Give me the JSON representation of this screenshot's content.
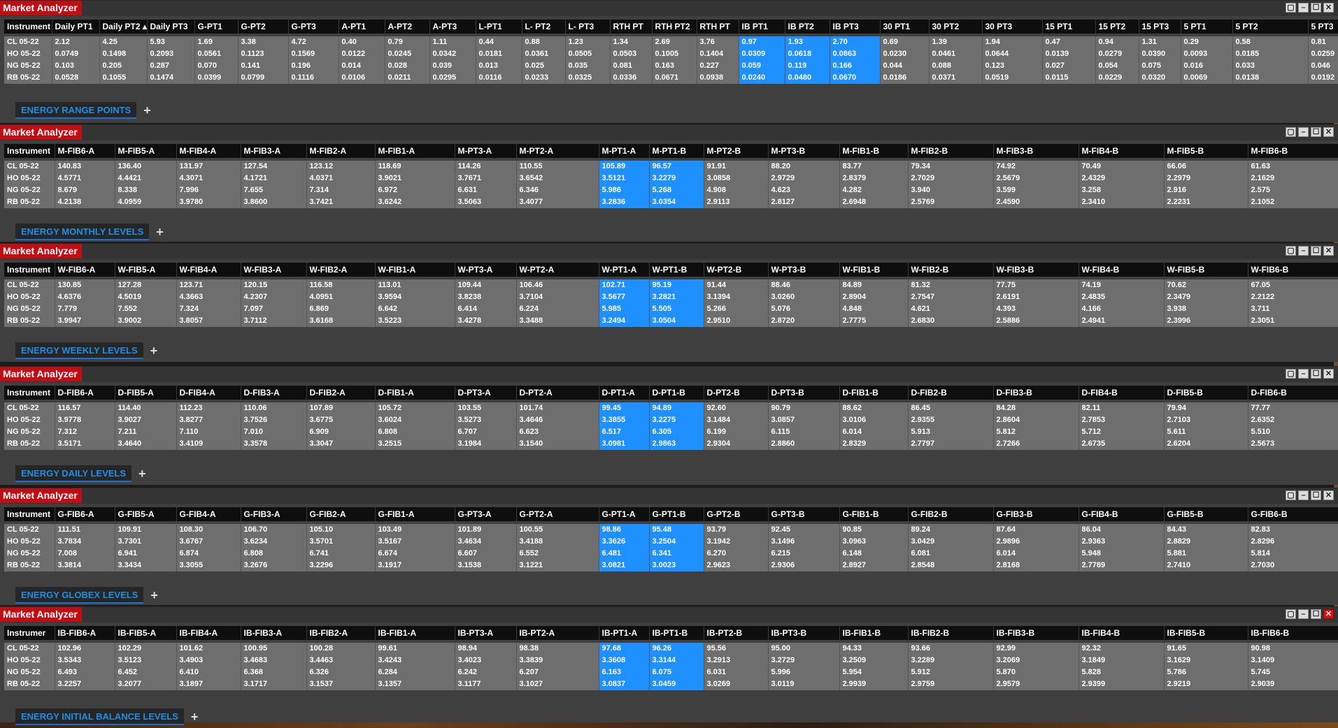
{
  "window_controls": {
    "restore": "▢",
    "minimize": "–",
    "maximize": "☐",
    "close": "✕"
  },
  "add_tab_label": "+",
  "panels": [
    {
      "title": "Market Analyzer",
      "tab": "ENERGY RANGE POINTS",
      "headers": [
        "Instrument",
        "Daily PT1",
        "Daily PT2 ▴",
        "Daily PT3",
        "G-PT1",
        "G-PT2",
        "G-PT3",
        "A-PT1",
        "A-PT2",
        "A-PT3",
        "L-PT1",
        "L- PT2",
        "L- PT3",
        "RTH PT",
        "RTH PT2",
        "RTH PT",
        "IB PT1",
        "IB PT2",
        "IB PT3",
        "30 PT1",
        "30 PT2",
        "30 PT3",
        "15 PT1",
        "15 PT2",
        "15 PT3",
        "5 PT1",
        "5 PT2",
        "5 PT3"
      ],
      "col_widths": [
        68,
        68,
        68,
        68,
        62,
        72,
        72,
        66,
        64,
        66,
        66,
        62,
        64,
        60,
        64,
        60,
        66,
        64,
        72,
        70,
        76,
        86,
        76,
        62,
        60,
        74,
        108,
        74
      ],
      "highlight_cols": [
        16,
        17,
        18
      ],
      "rows": [
        [
          "CL 05-22",
          "2.12",
          "4.25",
          "5.93",
          "1.69",
          "3.38",
          "4.72",
          "0.40",
          "0.79",
          "1.11",
          "0.44",
          "0.88",
          "1.23",
          "1.34",
          "2.69",
          "3.76",
          "0.97",
          "1.93",
          "2.70",
          "0.69",
          "1.39",
          "1.94",
          "0.47",
          "0.94",
          "1.31",
          "0.29",
          "0.58",
          "0.81"
        ],
        [
          "HO 05-22",
          "0.0749",
          "0.1498",
          "0.2093",
          "0.0561",
          "0.1123",
          "0.1569",
          "0.0122",
          "0.0245",
          "0.0342",
          "0.0181",
          "0.0361",
          "0.0505",
          "0.0503",
          "0.1005",
          "0.1404",
          "0.0309",
          "0.0618",
          "0.0863",
          "0.0230",
          "0.0461",
          "0.0644",
          "0.0139",
          "0.0279",
          "0.0390",
          "0.0093",
          "0.0185",
          "0.0259"
        ],
        [
          "NG 05-22",
          "0.103",
          "0.205",
          "0.287",
          "0.070",
          "0.141",
          "0.196",
          "0.014",
          "0.028",
          "0.039",
          "0.013",
          "0.025",
          "0.035",
          "0.081",
          "0.163",
          "0.227",
          "0.059",
          "0.119",
          "0.166",
          "0.044",
          "0.088",
          "0.123",
          "0.027",
          "0.054",
          "0.075",
          "0.016",
          "0.033",
          "0.046"
        ],
        [
          "RB 05-22",
          "0.0528",
          "0.1055",
          "0.1474",
          "0.0399",
          "0.0799",
          "0.1116",
          "0.0106",
          "0.0211",
          "0.0295",
          "0.0116",
          "0.0233",
          "0.0325",
          "0.0336",
          "0.0671",
          "0.0938",
          "0.0240",
          "0.0480",
          "0.0670",
          "0.0186",
          "0.0371",
          "0.0519",
          "0.0115",
          "0.0229",
          "0.0320",
          "0.0069",
          "0.0138",
          "0.0192"
        ]
      ]
    },
    {
      "title": "Market Analyzer",
      "tab": "ENERGY MONTHLY LEVELS",
      "headers": [
        "Instrument",
        "M-FIB6-A",
        "M-FIB5-A",
        "M-FIB4-A",
        "M-FIB3-A",
        "M-FIB2-A",
        "M-FIB1-A",
        "M-PT3-A",
        "M-PT2-A",
        "M-PT1-A",
        "M-PT1-B",
        "M-PT2-B",
        "M-PT3-B",
        "M-FIB1-B",
        "M-FIB2-B",
        "M-FIB3-B",
        "M-FIB4-B",
        "M-FIB5-B",
        "M-FIB6-B"
      ],
      "col_widths": [
        72,
        86,
        88,
        92,
        94,
        98,
        114,
        88,
        118,
        72,
        78,
        92,
        102,
        98,
        122,
        122,
        122,
        120,
        130
      ],
      "highlight_cols": [
        9,
        10
      ],
      "rows": [
        [
          "CL 05-22",
          "140.83",
          "136.40",
          "131.97",
          "127.54",
          "123.12",
          "118.69",
          "114.26",
          "110.55",
          "105.89",
          "96.57",
          "91.91",
          "88.20",
          "83.77",
          "79.34",
          "74.92",
          "70.49",
          "66.06",
          "61.63"
        ],
        [
          "HO 05-22",
          "4.5771",
          "4.4421",
          "4.3071",
          "4.1721",
          "4.0371",
          "3.9021",
          "3.7671",
          "3.6542",
          "3.5121",
          "3.2279",
          "3.0858",
          "2.9729",
          "2.8379",
          "2.7029",
          "2.5679",
          "2.4329",
          "2.2979",
          "2.1629"
        ],
        [
          "NG 05-22",
          "8.679",
          "8.338",
          "7.996",
          "7.655",
          "7.314",
          "6.972",
          "6.631",
          "6.346",
          "5.986",
          "5.268",
          "4.908",
          "4.623",
          "4.282",
          "3.940",
          "3.599",
          "3.258",
          "2.916",
          "2.575"
        ],
        [
          "RB 05-22",
          "4.2138",
          "4.0959",
          "3.9780",
          "3.8600",
          "3.7421",
          "3.6242",
          "3.5063",
          "3.4077",
          "3.2836",
          "3.0354",
          "2.9113",
          "2.8127",
          "2.6948",
          "2.5769",
          "2.4590",
          "2.3410",
          "2.2231",
          "2.1052"
        ]
      ]
    },
    {
      "title": "Market Analyzer",
      "tab": "ENERGY WEEKLY LEVELS",
      "headers": [
        "Instrument",
        "W-FIB6-A",
        "W-FIB5-A",
        "W-FIB4-A",
        "W-FIB3-A",
        "W-FIB2-A",
        "W-FIB1-A",
        "W-PT3-A",
        "W-PT2-A",
        "W-PT1-A",
        "W-PT1-B",
        "W-PT2-B",
        "W-PT3-B",
        "W-FIB1-B",
        "W-FIB2-B",
        "W-FIB3-B",
        "W-FIB4-B",
        "W-FIB5-B",
        "W-FIB6-B"
      ],
      "col_widths": [
        72,
        86,
        88,
        92,
        94,
        98,
        114,
        88,
        118,
        72,
        78,
        92,
        102,
        98,
        122,
        122,
        122,
        120,
        130
      ],
      "highlight_cols": [
        9,
        10
      ],
      "rows": [
        [
          "CL 05-22",
          "130.85",
          "127.28",
          "123.71",
          "120.15",
          "116.58",
          "113.01",
          "109.44",
          "106.46",
          "102.71",
          "95.19",
          "91.44",
          "88.46",
          "84.89",
          "81.32",
          "77.75",
          "74.19",
          "70.62",
          "67.05"
        ],
        [
          "HO 05-22",
          "4.6376",
          "4.5019",
          "4.3663",
          "4.2307",
          "4.0951",
          "3.9594",
          "3.8238",
          "3.7104",
          "3.5677",
          "3.2821",
          "3.1394",
          "3.0260",
          "2.8904",
          "2.7547",
          "2.6191",
          "2.4835",
          "2.3479",
          "2.2122"
        ],
        [
          "NG 05-22",
          "7.779",
          "7.552",
          "7.324",
          "7.097",
          "6.869",
          "6.642",
          "6.414",
          "6.224",
          "5.985",
          "5.505",
          "5.266",
          "5.076",
          "4.848",
          "4.621",
          "4.393",
          "4.166",
          "3.938",
          "3.711"
        ],
        [
          "RB 05-22",
          "3.9947",
          "3.9002",
          "3.8057",
          "3.7112",
          "3.6168",
          "3.5223",
          "3.4278",
          "3.3488",
          "3.2494",
          "3.0504",
          "2.9510",
          "2.8720",
          "2.7775",
          "2.6830",
          "2.5886",
          "2.4941",
          "2.3996",
          "2.3051"
        ]
      ]
    },
    {
      "title": "Market Analyzer",
      "tab": "ENERGY DAILY LEVELS",
      "headers": [
        "Instrument",
        "D-FIB6-A",
        "D-FIB5-A",
        "D-FIB4-A",
        "D-FIB3-A",
        "D-FIB2-A",
        "D-FIB1-A",
        "D-PT3-A",
        "D-PT2-A",
        "D-PT1-A",
        "D-PT1-B",
        "D-PT2-B",
        "D-PT3-B",
        "D-FIB1-B",
        "D-FIB2-B",
        "D-FIB3-B",
        "D-FIB4-B",
        "D-FIB5-B",
        "D-FIB6-B"
      ],
      "col_widths": [
        72,
        86,
        88,
        92,
        94,
        98,
        114,
        88,
        118,
        72,
        78,
        92,
        102,
        98,
        122,
        122,
        122,
        120,
        130
      ],
      "highlight_cols": [
        9,
        10
      ],
      "rows": [
        [
          "CL 05-22",
          "116.57",
          "114.40",
          "112.23",
          "110.06",
          "107.89",
          "105.72",
          "103.55",
          "101.74",
          "99.45",
          "94.89",
          "92.60",
          "90.79",
          "88.62",
          "86.45",
          "84.28",
          "82.11",
          "79.94",
          "77.77"
        ],
        [
          "HO 05-22",
          "3.9778",
          "3.9027",
          "3.8277",
          "3.7526",
          "3.6775",
          "3.6024",
          "3.5273",
          "3.4646",
          "3.3855",
          "3.2275",
          "3.1484",
          "3.0857",
          "3.0106",
          "2.9355",
          "2.8604",
          "2.7853",
          "2.7103",
          "2.6352"
        ],
        [
          "NG 05-22",
          "7.312",
          "7.211",
          "7.110",
          "7.010",
          "6.909",
          "6.808",
          "6.707",
          "6.623",
          "6.517",
          "6.305",
          "6.199",
          "6.115",
          "6.014",
          "5.913",
          "5.812",
          "5.712",
          "5.611",
          "5.510"
        ],
        [
          "RB 05-22",
          "3.5171",
          "3.4640",
          "3.4109",
          "3.3578",
          "3.3047",
          "3.2515",
          "3.1984",
          "3.1540",
          "3.0981",
          "2.9863",
          "2.9304",
          "2.8860",
          "2.8329",
          "2.7797",
          "2.7266",
          "2.6735",
          "2.6204",
          "2.5673"
        ]
      ]
    },
    {
      "title": "Market Analyzer",
      "tab": "ENERGY GLOBEX LEVELS",
      "headers": [
        "Instrument",
        "G-FIB6-A",
        "G-FIB5-A",
        "G-FIB4-A",
        "G-FIB3-A",
        "G-FIB2-A",
        "G-FIB1-A",
        "G-PT3-A",
        "G-PT2-A",
        "G-PT1-A",
        "G-PT1-B",
        "G-PT2-B",
        "G-PT3-B",
        "G-FIB1-B",
        "G-FIB2-B",
        "G-FIB3-B",
        "G-FIB4-B",
        "G-FIB5-B",
        "G-FIB6-B"
      ],
      "col_widths": [
        72,
        86,
        88,
        92,
        94,
        98,
        114,
        88,
        118,
        72,
        78,
        92,
        102,
        98,
        122,
        122,
        122,
        120,
        130
      ],
      "highlight_cols": [
        9,
        10
      ],
      "rows": [
        [
          "CL 05-22",
          "111.51",
          "109.91",
          "108.30",
          "106.70",
          "105.10",
          "103.49",
          "101.89",
          "100.55",
          "98.86",
          "95.48",
          "93.79",
          "92.45",
          "90.85",
          "89.24",
          "87.64",
          "86.04",
          "84.43",
          "82.83"
        ],
        [
          "HO 05-22",
          "3.7834",
          "3.7301",
          "3.6767",
          "3.6234",
          "3.5701",
          "3.5167",
          "3.4634",
          "3.4188",
          "3.3626",
          "3.2504",
          "3.1942",
          "3.1496",
          "3.0963",
          "3.0429",
          "2.9896",
          "2.9363",
          "2.8829",
          "2.8296"
        ],
        [
          "NG 05-22",
          "7.008",
          "6.941",
          "6.874",
          "6.808",
          "6.741",
          "6.674",
          "6.607",
          "6.552",
          "6.481",
          "6.341",
          "6.270",
          "6.215",
          "6.148",
          "6.081",
          "6.014",
          "5.948",
          "5.881",
          "5.814"
        ],
        [
          "RB 05-22",
          "3.3814",
          "3.3434",
          "3.3055",
          "3.2676",
          "3.2296",
          "3.1917",
          "3.1538",
          "3.1221",
          "3.0821",
          "3.0023",
          "2.9623",
          "2.9306",
          "2.8927",
          "2.8548",
          "2.8168",
          "2.7789",
          "2.7410",
          "2.7030"
        ]
      ]
    },
    {
      "title": "Market Analyzer",
      "tab": "ENERGY INITIAL BALANCE LEVELS",
      "headers": [
        "Instrumer",
        "IB-FIB6-A",
        "IB-FIB5-A",
        "IB-FIB4-A",
        "IB-FIB3-A",
        "IB-FIB2-A",
        "IB-FIB1-A",
        "IB-PT3-A",
        "IB-PT2-A",
        "IB-PT1-A",
        "IB-PT1-B",
        "IB-PT2-B",
        "IB-PT3-B",
        "IB-FIB1-B",
        "IB-FIB2-B",
        "IB-FIB3-B",
        "IB-FIB4-B",
        "IB-FIB5-B",
        "IB-FIB6-B"
      ],
      "col_widths": [
        72,
        86,
        88,
        92,
        94,
        98,
        114,
        88,
        118,
        72,
        78,
        92,
        102,
        98,
        122,
        122,
        122,
        120,
        130
      ],
      "highlight_cols": [
        9,
        10
      ],
      "rows": [
        [
          "CL 05-22",
          "102.96",
          "102.29",
          "101.62",
          "100.95",
          "100.28",
          "99.61",
          "98.94",
          "98.38",
          "97.68",
          "96.26",
          "95.56",
          "95.00",
          "94.33",
          "93.66",
          "92.99",
          "92.32",
          "91.65",
          "90.98"
        ],
        [
          "HO 05-22",
          "3.5343",
          "3.5123",
          "3.4903",
          "3.4683",
          "3.4463",
          "3.4243",
          "3.4023",
          "3.3839",
          "3.3608",
          "3.3144",
          "3.2913",
          "3.2729",
          "3.2509",
          "3.2289",
          "3.2069",
          "3.1849",
          "3.1629",
          "3.1409"
        ],
        [
          "NG 05-22",
          "6.493",
          "6.452",
          "6.410",
          "6.368",
          "6.326",
          "6.284",
          "6.242",
          "6.207",
          "6.163",
          "6.075",
          "6.031",
          "5.996",
          "5.954",
          "5.912",
          "5.870",
          "5.828",
          "5.786",
          "5.745"
        ],
        [
          "RB 05-22",
          "3.2257",
          "3.2077",
          "3.1897",
          "3.1717",
          "3.1537",
          "3.1357",
          "3.1177",
          "3.1027",
          "3.0837",
          "3.0459",
          "3.0269",
          "3.0119",
          "2.9939",
          "2.9759",
          "2.9579",
          "2.9399",
          "2.9219",
          "2.9039"
        ]
      ]
    }
  ]
}
